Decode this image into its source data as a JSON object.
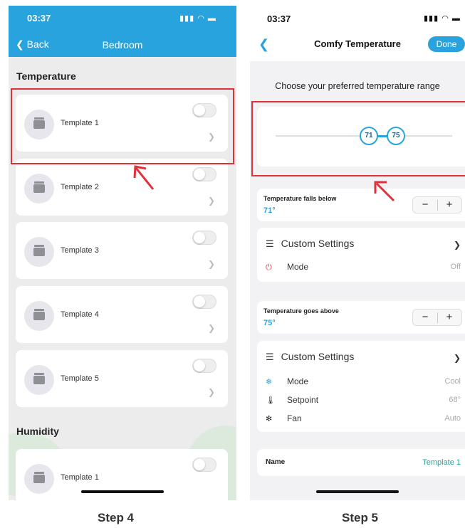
{
  "step4": {
    "status_time": "03:37",
    "back_label": "Back",
    "title": "Bedroom",
    "section_temperature": "Temperature",
    "templates": [
      "Template 1",
      "Template 2",
      "Template 3",
      "Template 4",
      "Template 5"
    ],
    "section_humidity": "Humidity",
    "humidity_templates": [
      "Template 1"
    ],
    "caption": "Step 4"
  },
  "step5": {
    "status_time": "03:37",
    "title": "Comfy Temperature",
    "done_label": "Done",
    "instruction": "Choose your preferred temperature range",
    "slider": {
      "low": "71",
      "high": "75",
      "low_value": 71,
      "high_value": 75
    },
    "below": {
      "title": "Temperature falls below",
      "value": "71°",
      "minus": "−",
      "plus": "+",
      "settings_label": "Custom Settings",
      "rows": [
        {
          "label": "Mode",
          "value": "Off",
          "icon": "power-icon"
        }
      ]
    },
    "above": {
      "title": "Temperature goes above",
      "value": "75°",
      "minus": "−",
      "plus": "+",
      "settings_label": "Custom Settings",
      "rows": [
        {
          "label": "Mode",
          "value": "Cool",
          "icon": "snowflake-icon"
        },
        {
          "label": "Setpoint",
          "value": "68°",
          "icon": "thermometer-icon"
        },
        {
          "label": "Fan",
          "value": "Auto",
          "icon": "fan-icon"
        }
      ]
    },
    "name_label": "Name",
    "name_value": "Template 1",
    "caption": "Step 5"
  },
  "colors": {
    "accent": "#29a3dd",
    "highlight": "#e0303a"
  }
}
